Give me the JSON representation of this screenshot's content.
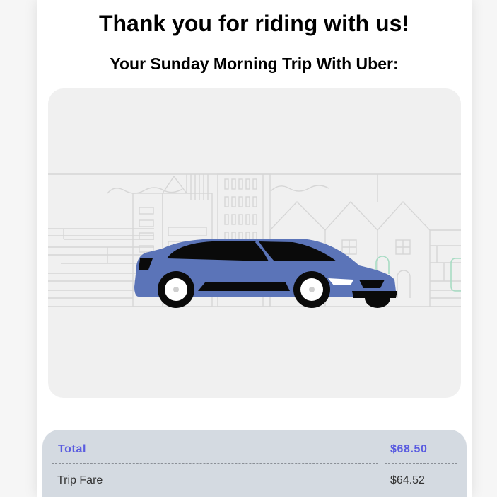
{
  "header": {
    "title": "Thank you for riding with us!",
    "subtitle": "Your Sunday Morning Trip With Uber:"
  },
  "illustration": {
    "car_color": "#5b74b8",
    "background": "#f0f0f0",
    "line_color": "#d8d8d8",
    "accent_color": "#a8dcc4"
  },
  "receipt": {
    "total_label": "Total",
    "total_value": "$68.50",
    "rows": [
      {
        "label": "Trip Fare",
        "value": "$64.52"
      }
    ],
    "accent_color": "#5a5ce0"
  }
}
